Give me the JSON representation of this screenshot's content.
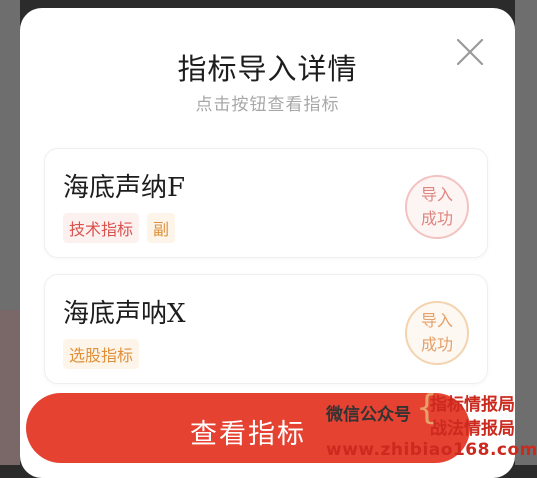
{
  "dialog": {
    "title": "指标导入详情",
    "subtitle": "点击按钮查看指标",
    "close_icon": "close-icon"
  },
  "indicators": [
    {
      "name": "海底声纳F",
      "tags": [
        "技术指标",
        "副"
      ],
      "status_line1": "导入",
      "status_line2": "成功"
    },
    {
      "name": "海底声呐X",
      "tags": [
        "选股指标"
      ],
      "status_line1": "导入",
      "status_line2": "成功"
    }
  ],
  "actions": {
    "view_label": "查看指标"
  },
  "watermark": {
    "line1": "微信公众号",
    "line2": "指标情报局",
    "line3": "战法情报局",
    "url": "www.zhibiao168.com"
  },
  "colors": {
    "accent": "#e64232",
    "tag_red": "#d9534f",
    "tag_orange": "#e0903a"
  }
}
